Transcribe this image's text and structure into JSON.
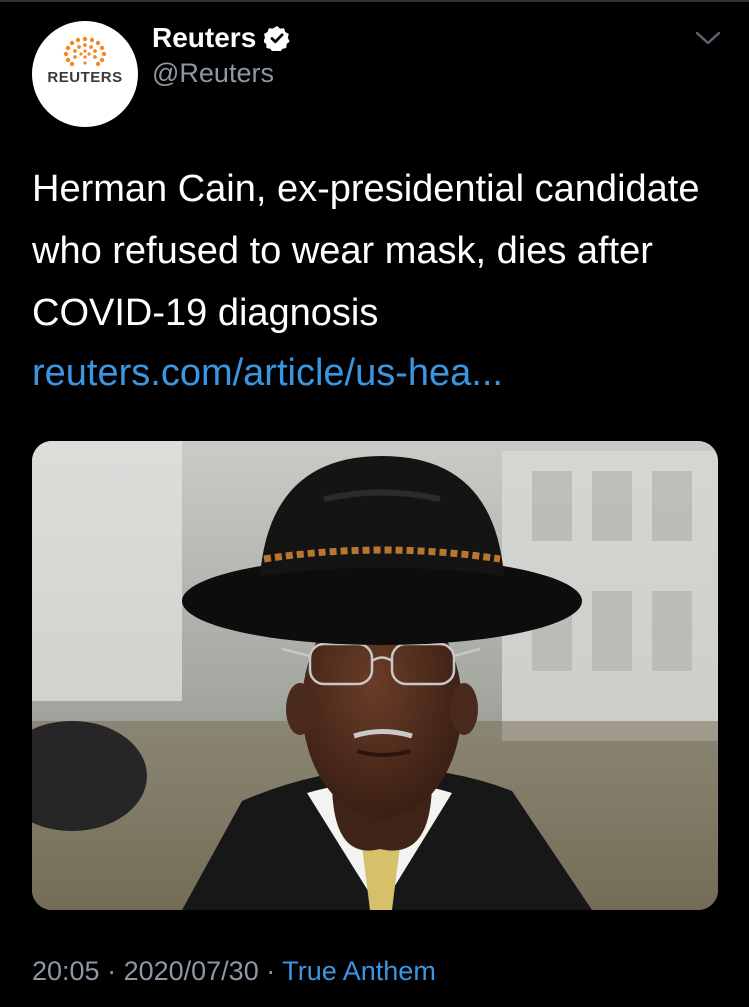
{
  "account": {
    "display_name": "Reuters",
    "handle": "@Reuters",
    "avatar_wordmark": "REUTERS",
    "verified": true
  },
  "tweet": {
    "text": "Herman Cain, ex-presidential candidate who refused to wear mask, dies after COVID-19 diagnosis",
    "link": "reuters.com/article/us-hea...",
    "image": "photo-of-man-in-black-hat-and-glasses"
  },
  "meta": {
    "time": "20:05",
    "sep1": " · ",
    "date": "2020/07/30",
    "sep2": " · ",
    "source": "True Anthem"
  },
  "colors": {
    "background": "#000000",
    "text": "#ffffff",
    "secondary": "#8b98a5",
    "link": "#3b96e2"
  },
  "icons": [
    "reuters-logo-icon",
    "verified-badge-icon",
    "chevron-down-icon"
  ]
}
